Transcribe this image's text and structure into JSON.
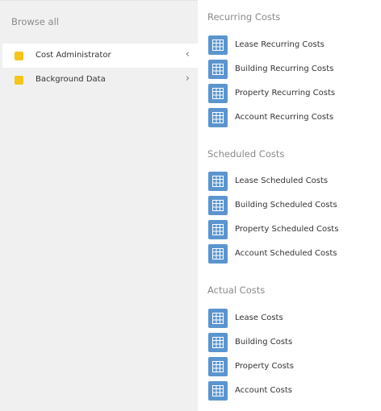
{
  "sidebar": {
    "title": "Browse all",
    "items": [
      {
        "label": "Cost Administrator",
        "chevron": "‹",
        "color": "#f5c518"
      },
      {
        "label": "Background Data",
        "chevron": "›",
        "color": "#f5c518"
      }
    ]
  },
  "sections": [
    {
      "title": "Recurring Costs",
      "items": [
        {
          "label": "Lease Recurring Costs",
          "icon": "table-icon"
        },
        {
          "label": "Building Recurring Costs",
          "icon": "table-icon"
        },
        {
          "label": "Property Recurring Costs",
          "icon": "table-icon"
        },
        {
          "label": "Account Recurring Costs",
          "icon": "table-icon"
        }
      ]
    },
    {
      "title": "Scheduled Costs",
      "items": [
        {
          "label": "Lease Scheduled Costs",
          "icon": "table-icon"
        },
        {
          "label": "Building Scheduled Costs",
          "icon": "table-icon"
        },
        {
          "label": "Property Scheduled Costs",
          "icon": "table-icon"
        },
        {
          "label": "Account Scheduled Costs",
          "icon": "table-icon"
        }
      ]
    },
    {
      "title": "Actual Costs",
      "items": [
        {
          "label": "Lease Costs",
          "icon": "table-icon"
        },
        {
          "label": "Building Costs",
          "icon": "table-icon"
        },
        {
          "label": "Property Costs",
          "icon": "table-icon"
        },
        {
          "label": "Account Costs",
          "icon": "table-icon"
        }
      ]
    }
  ],
  "colors": {
    "icon_bg": "#5b95d0",
    "sidebar_bg": "#f0f0f0",
    "folder_dot": "#f5c518"
  }
}
